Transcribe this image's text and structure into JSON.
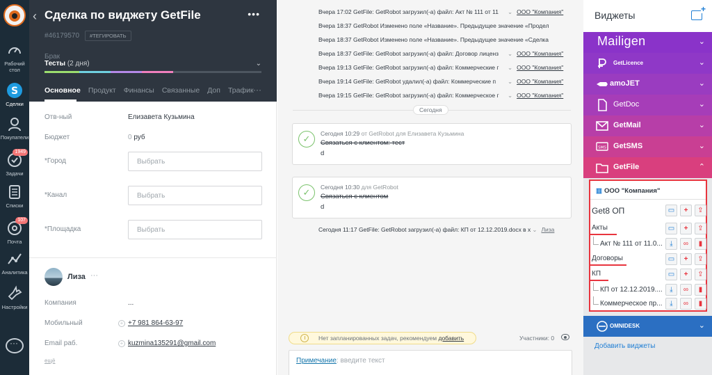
{
  "nav": {
    "items": [
      {
        "label": "Рабочий стол",
        "icon": "dashboard-icon"
      },
      {
        "label": "Сделки",
        "icon": "deals-icon",
        "active": true
      },
      {
        "label": "Покупатели",
        "icon": "customers-icon"
      },
      {
        "label": "Задачи",
        "icon": "tasks-icon",
        "badge": "1949"
      },
      {
        "label": "Списки",
        "icon": "lists-icon"
      },
      {
        "label": "Почта",
        "icon": "mail-icon",
        "badge": "107"
      },
      {
        "label": "Аналитика",
        "icon": "analytics-icon"
      },
      {
        "label": "Настройки",
        "icon": "settings-icon"
      }
    ]
  },
  "lead": {
    "title": "Сделка по виджету GetFile",
    "id": "#46179570",
    "tag_button": "#ТЕГИРОВАТЬ",
    "pipeline": "Брак",
    "stage": "Тесты",
    "stage_days": "(2 дня)",
    "tabs": [
      "Основное",
      "Продукт",
      "Финансы",
      "Связанные",
      "Доп",
      "Трафик"
    ],
    "fields": {
      "responsible_label": "Отв-ный",
      "responsible_value": "Елизавета Кузьмина",
      "budget_label": "Бюджет",
      "budget_value": "0",
      "budget_currency": "руб",
      "city_label": "*Город",
      "city_placeholder": "Выбрать",
      "channel_label": "*Канал",
      "channel_placeholder": "Выбрать",
      "platform_label": "*Площадка",
      "platform_placeholder": "Выбрать"
    },
    "contact": {
      "name": "Лиза",
      "more": "···",
      "company_label": "Компания",
      "company_value": "...",
      "mobile_label": "Мобильный",
      "mobile_value": "+7 981 864-63-97",
      "email_label": "Email раб.",
      "email_value": "kuzmina135291@gmail.com",
      "more_link": "ещё"
    }
  },
  "feed": {
    "rows": [
      {
        "text": "Вчера 17:02 GetFile: GetRobot загрузил(-а) файл: Акт № 111 от 11",
        "company": "ООО \"Компания\""
      },
      {
        "text": "Вчера 18:37 GetRobot   Изменено поле «Название». Предыдущее значение «Продел",
        "company": ""
      },
      {
        "text": "Вчера 18:37 GetRobot   Изменено поле «Название». Предыдущее значение «Сделка",
        "company": ""
      },
      {
        "text": "Вчера 18:37 GetFile: GetRobot загрузил(-а) файл: Договор лиценз",
        "company": "ООО \"Компания\""
      },
      {
        "text": "Вчера 19:13 GetFile: GetRobot загрузил(-а) файл: Коммерческие г",
        "company": "ООО \"Компания\""
      },
      {
        "text": "Вчера 19:14 GetFile: GetRobot удалил(-а) файл: Коммерческие п",
        "company": "ООО \"Компания\""
      },
      {
        "text": "Вчера 19:15 GetFile: GetRobot загрузил(-а) файл: Коммерческое г",
        "company": "ООО \"Компания\""
      }
    ],
    "today_label": "Сегодня",
    "tasks": [
      {
        "time": "Сегодня 10:29",
        "from": "от GetRobot для Елизавета Кузьмина",
        "subject": "Связаться с клиентом: тест",
        "body": "d"
      },
      {
        "time": "Сегодня 10:30",
        "from": "для GetRobot",
        "subject": "Связаться с клиентом",
        "body": "d"
      }
    ],
    "file_event": {
      "text": "Сегодня 11:17 GetFile: GetRobot загрузил(-а) файл: КП от 12.12.2019.docx в х",
      "link": "Лиза"
    },
    "notice": {
      "text": "Нет запланированных задач, рекомендуем ",
      "link": "добавить"
    },
    "participants": "Участники: 0",
    "note": {
      "label": "Примечание",
      "placeholder": ": введите текст"
    }
  },
  "widgets": {
    "title": "Виджеты",
    "bars": [
      {
        "name": "Mailigen",
        "color": "#8a33c9"
      },
      {
        "name": "GetLicence",
        "color": "#8f38c7"
      },
      {
        "name": "amoJET",
        "color": "#9a3cc0"
      },
      {
        "name": "GetDoc",
        "color": "#a63db8"
      },
      {
        "name": "GetMail",
        "color": "#b73ea8"
      },
      {
        "name": "GetSMS",
        "color": "#c93f93"
      },
      {
        "name": "GetFile",
        "color": "#d93f7e"
      }
    ],
    "getfile": {
      "company": "ООО \"Компания\"",
      "root": "Get8 ОП",
      "folders": [
        {
          "name": "Акты",
          "files": [
            "Акт № 111 от 11.0..."
          ]
        },
        {
          "name": "Договоры",
          "files": []
        },
        {
          "name": "КП",
          "files": [
            "КП от 12.12.2019....",
            "Коммерческое пр..."
          ]
        }
      ]
    },
    "omnidesk": {
      "name": "OMNIDESK",
      "color": "#2b6fc2"
    },
    "add_widgets": "Добавить виджеты"
  }
}
